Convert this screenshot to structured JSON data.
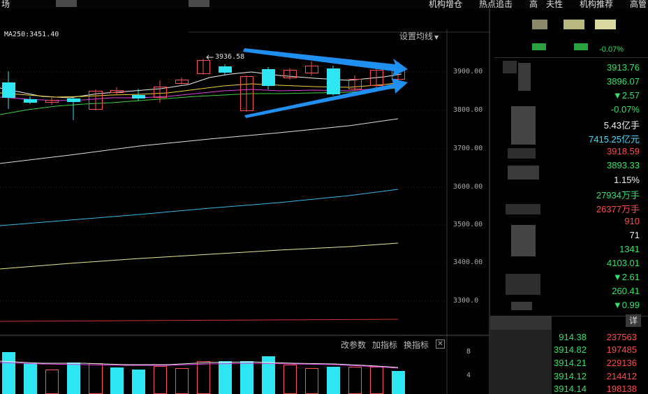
{
  "menu": {
    "tabs": [
      "场",
      "机构增仓",
      "热点追击",
      "高",
      "夫性",
      "机构推荐",
      "高管"
    ]
  },
  "chart": {
    "ma_label": "MA250:3451.40",
    "setting_label": "设置均线",
    "high_annotation": "3936.58",
    "y_ticks": [
      "3900.00",
      "3800.00",
      "3700.00",
      "3600.00",
      "3500.00",
      "3400.00",
      "3300.0"
    ],
    "sub_ticks": [
      "8",
      "4"
    ],
    "sub_toolbar": {
      "params": "改参数",
      "add": "加指标",
      "switch": "换指标"
    }
  },
  "quote": {
    "rows": [
      {
        "text": "3913.76",
        "color": "#33e06a"
      },
      {
        "text": "3896.07",
        "color": "#33e06a"
      },
      {
        "text": "▼2.57",
        "color": "#33e06a"
      },
      {
        "text": "-0.07%",
        "color": "#33e06a"
      },
      {
        "text": "5.43亿手",
        "color": "#f0f0f0"
      },
      {
        "text": "7415.25亿元",
        "color": "#40e0ff"
      },
      {
        "text": "3918.59",
        "color": "#ff4a4a"
      },
      {
        "text": "3893.33",
        "color": "#33e06a"
      },
      {
        "text": "1.15%",
        "color": "#f0f0f0"
      },
      {
        "text": "27934万手",
        "color": "#33e06a"
      },
      {
        "text": "26377万手",
        "color": "#ff4a4a"
      },
      {
        "text": "910",
        "color": "#ff4a4a"
      },
      {
        "text": "71",
        "color": "#f0f0f0"
      },
      {
        "text": "1341",
        "color": "#33e06a"
      },
      {
        "text": "4103.01",
        "color": "#33e06a"
      },
      {
        "text": "▼2.61",
        "color": "#33e06a"
      },
      {
        "text": "260.41",
        "color": "#33e06a"
      },
      {
        "text": "▼0.99",
        "color": "#33e06a"
      }
    ],
    "top_partial": "-0.07%",
    "detail_label": "详"
  },
  "trades": [
    {
      "price": "914.38",
      "volume": "237563"
    },
    {
      "price": "3914.82",
      "volume": "197485"
    },
    {
      "price": "3914.21",
      "volume": "229136"
    },
    {
      "price": "3914.12",
      "volume": "214412"
    },
    {
      "price": "3914.14",
      "volume": "198138"
    }
  ]
}
